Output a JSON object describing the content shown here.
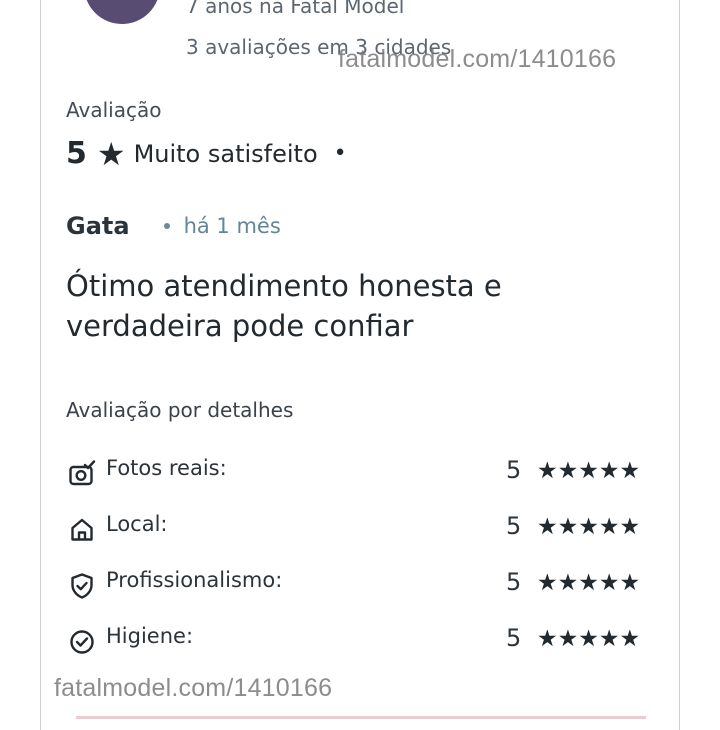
{
  "profile": {
    "years_text": "7 anos na Fatal Model",
    "reviews_text": "3 avaliações em 3 cidades"
  },
  "watermark": {
    "top": "fatalmodel.com/1410166",
    "bottom": "fatalmodel.com/1410166"
  },
  "review": {
    "section_label": "Avaliação",
    "score": "5",
    "star": "★",
    "satisfaction": "Muito satisfeito",
    "dot": "•",
    "reviewer_name": "Gata",
    "time_ago": "há 1 mês",
    "comment": "Ótimo atendimento honesta e verdadeira pode confiar"
  },
  "details": {
    "label": "Avaliação por detalhes",
    "items": [
      {
        "label": "Fotos reais:",
        "score": "5",
        "stars": "★★★★★",
        "icon": "camera-check-icon",
        "rating": 5
      },
      {
        "label": "Local:",
        "score": "5",
        "stars": "★★★★★",
        "icon": "home-icon",
        "rating": 5
      },
      {
        "label": "Profissionalismo:",
        "score": "5",
        "stars": "★★★★★",
        "icon": "shield-check-icon",
        "rating": 5
      },
      {
        "label": "Higiene:",
        "score": "5",
        "stars": "★★★★★",
        "icon": "circle-check-icon",
        "rating": 5
      }
    ]
  },
  "colors": {
    "text": "#222a30",
    "muted": "#5c6670",
    "time_accent": "#5e8799",
    "avatar": "#584c73",
    "card_border": "#cfcfcf"
  }
}
